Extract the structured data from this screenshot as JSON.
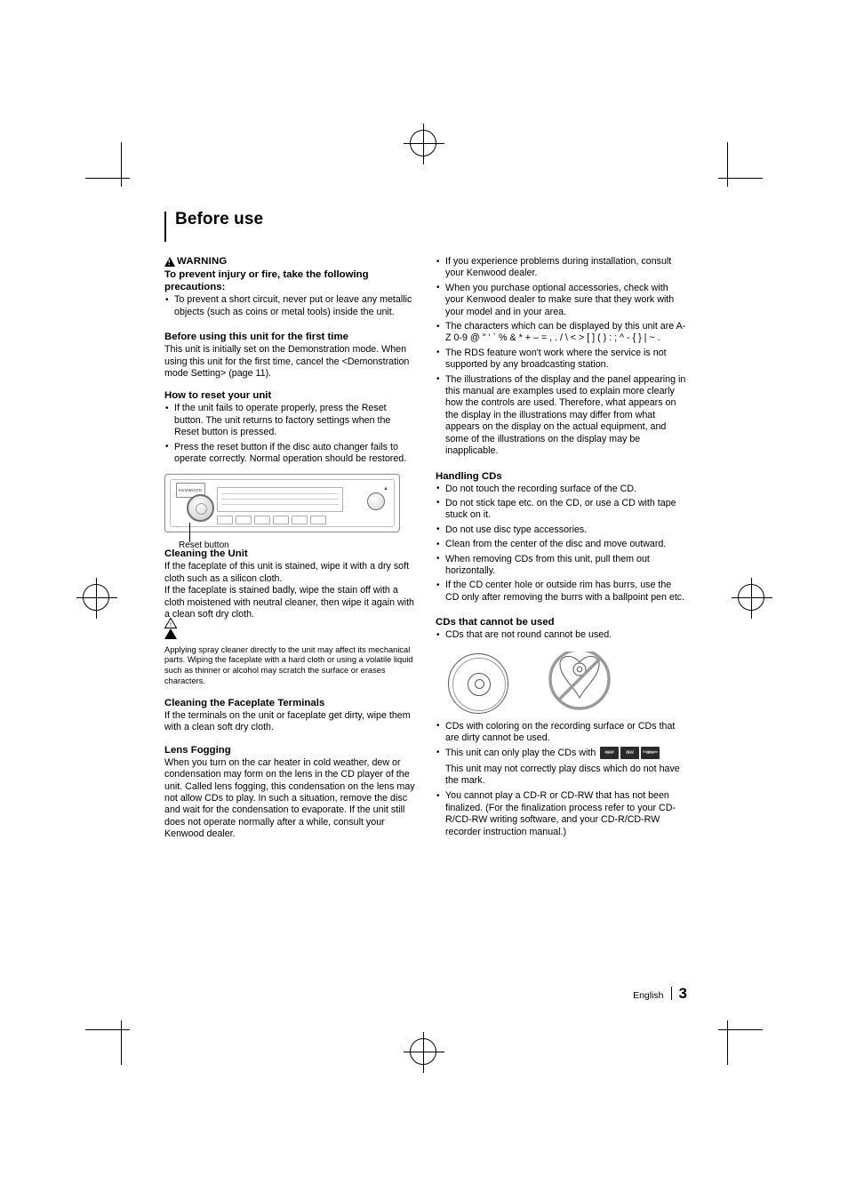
{
  "page": {
    "title": "Before use",
    "footer": {
      "language": "English",
      "number": "3"
    }
  },
  "left_column": {
    "warning": {
      "icon": "warning-triangle-icon",
      "label": "WARNING",
      "heading": "To prevent injury or fire, take the following precautions:",
      "bullets": [
        "To prevent a short circuit, never put or leave any metallic objects (such as coins or metal tools) inside the unit."
      ]
    },
    "first_time": {
      "heading": "Before using this unit for the first time",
      "body": "This unit is initially set on the Demonstration mode. When using this unit for the first time, cancel the <Demonstration mode Setting> (page 11)."
    },
    "reset": {
      "heading": "How to reset your unit",
      "bullets": [
        "If the unit fails to operate properly, press the Reset button. The unit returns to factory settings when the Reset button is pressed.",
        "Press the reset button if the disc auto changer fails to operate correctly. Normal operation should be restored."
      ],
      "figure_caption": "Reset button",
      "faceplate_brand": "KENWOOD"
    },
    "cleaning_unit": {
      "heading": "Cleaning the Unit",
      "body1": "If the faceplate of this unit is stained, wipe it with a dry soft cloth such as a silicon cloth.",
      "body2": "If the faceplate is stained badly, wipe the stain off with a cloth moistened with neutral cleaner, then wipe it again with a clean soft dry cloth.",
      "caution_icon": "caution-triangle-icon",
      "caution": "Applying spray cleaner directly to the unit may affect its mechanical parts. Wiping the faceplate with a hard cloth or using a volatile liquid such as thinner or alcohol may scratch the surface or erases characters."
    },
    "faceplate_terminals": {
      "heading": "Cleaning the Faceplate Terminals",
      "body": "If the terminals on the unit or faceplate get dirty, wipe them with a clean soft dry cloth."
    },
    "lens_fogging": {
      "heading": "Lens Fogging",
      "body": "When you turn on the car heater in cold weather, dew or condensation may form on the lens in the CD player of the unit. Called lens fogging,  this condensation on the lens may not allow CDs to play. In such a situation, remove the disc and wait for the condensation to evaporate. If the unit still does not operate normally after a while, consult your Kenwood dealer."
    }
  },
  "right_column": {
    "notes": [
      "If you experience problems during installation, consult your Kenwood dealer.",
      "When you purchase optional accessories, check with your Kenwood dealer to make sure that they work with your model and in your area.",
      "The characters which can be displayed by this unit are A-Z 0-9 @ \" ' ` % & * + – = , . / \\ < > [ ] ( ) : ; ^ - { } | ~ .",
      "The RDS feature won't work where the service is not supported by any broadcasting station.",
      "The illustrations of the display and the panel appearing in this manual are examples used to explain more clearly how the controls are used. Therefore, what appears on the display in the illustrations may differ from what appears on the display on the actual equipment, and some of the illustrations on the display may be inapplicable."
    ],
    "handling_cds": {
      "heading": "Handling CDs",
      "bullets": [
        "Do not touch the recording surface of the CD.",
        "Do not stick tape etc. on the CD, or use a CD with tape stuck on it.",
        "Do not use disc type accessories.",
        "Clean from the center of the disc and move outward.",
        "When removing CDs from this unit, pull them out horizontally.",
        "If the CD center hole or outside rim has burrs, use the CD only after removing the burrs with a ballpoint pen etc."
      ]
    },
    "cds_not_used": {
      "heading": "CDs that cannot be used",
      "first_bullet": "CDs that are not round cannot be used.",
      "figure_round_disc": "round-cd-icon",
      "figure_shaped_disc": "non-round-cd-prohibited-icon",
      "bullets_after": [
        "CDs with coloring on the recording surface or CDs that are dirty cannot be used."
      ],
      "mark_bullet_prefix": "This unit can only play the CDs with",
      "mark_logos": [
        {
          "top": "disc",
          "bottom": "DIGITAL AUDIO"
        },
        {
          "top": "disc",
          "bottom": "TEXT"
        },
        {
          "top": "disc",
          "bottom": "ReWritable"
        }
      ],
      "mark_note": "This unit may not correctly play discs which do not have the mark.",
      "last_bullet": "You cannot play a CD-R or CD-RW that has not been finalized. (For the finalization process refer to your CD-R/CD-RW writing software, and your CD-R/CD-RW recorder instruction manual.)"
    }
  }
}
